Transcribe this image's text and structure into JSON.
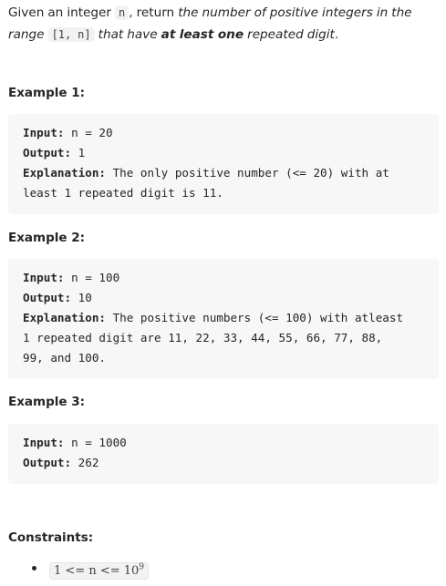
{
  "intro": {
    "text1": "Given an integer ",
    "var_n": "n",
    "text2": ", return ",
    "em1": "the number of positive integers in the range ",
    "range_code": "[1, n]",
    "em2": " that have ",
    "strong": "at least one",
    "em3": " repeated digit",
    "end": "."
  },
  "examples": [
    {
      "title": "Example 1:",
      "input_label": "Input:",
      "input_value": " n = 20",
      "output_label": "Output:",
      "output_value": " 1",
      "explanation_label": "Explanation:",
      "explanation_line1": " The only positive number (<= 20) with at",
      "explanation_line2": "least 1 repeated digit is 11."
    },
    {
      "title": "Example 2:",
      "input_label": "Input:",
      "input_value": " n = 100",
      "output_label": "Output:",
      "output_value": " 10",
      "explanation_label": "Explanation:",
      "explanation_line1": " The positive numbers (<= 100) with atleast",
      "explanation_line2": "1 repeated digit are 11, 22, 33, 44, 55, 66, 77, 88,",
      "explanation_line3": "99, and 100."
    },
    {
      "title": "Example 3:",
      "input_label": "Input:",
      "input_value": " n = 1000",
      "output_label": "Output:",
      "output_value": " 262"
    }
  ],
  "constraints": {
    "title": "Constraints:",
    "items": [
      {
        "base": "1 <= n <= 10",
        "exp": "9"
      }
    ]
  }
}
